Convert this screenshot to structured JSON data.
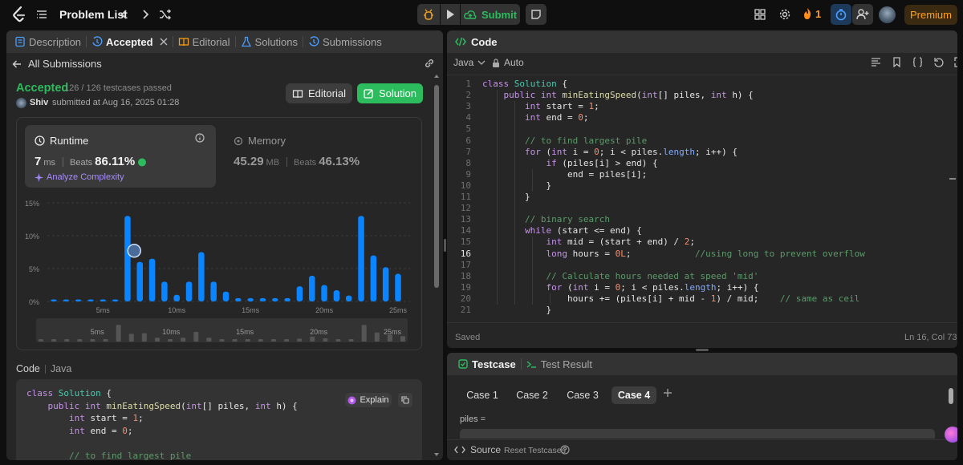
{
  "topbar": {
    "problem_list": "Problem List",
    "submit": "Submit",
    "streak": "1",
    "premium": "Premium"
  },
  "left_tabs": {
    "description": "Description",
    "accepted": "Accepted",
    "editorial": "Editorial",
    "solutions": "Solutions",
    "submissions": "Submissions"
  },
  "submission": {
    "back": "All Submissions",
    "status": "Accepted",
    "passed": "126 / 126 testcases passed",
    "user": "Shiv",
    "submitted": "submitted at Aug 16, 2025 01:28",
    "editorial_btn": "Editorial",
    "solution_btn": "Solution"
  },
  "stats": {
    "runtime_label": "Runtime",
    "runtime_value": "7",
    "runtime_unit": "ms",
    "beats_label": "Beats",
    "runtime_beats": "86.11%",
    "analyze": "Analyze Complexity",
    "memory_label": "Memory",
    "memory_value": "45.29",
    "memory_unit": "MB",
    "memory_beats": "46.13%"
  },
  "chart_data": {
    "type": "bar",
    "yticks": [
      "15%",
      "10%",
      "5%",
      "0%"
    ],
    "ylim": [
      0,
      15
    ],
    "xticks": [
      "5ms",
      "10ms",
      "15ms",
      "20ms",
      "25ms"
    ],
    "values": [
      0.3,
      0.3,
      0.3,
      0.3,
      0.3,
      0.3,
      13,
      6,
      6.5,
      3,
      1,
      3,
      7.5,
      3,
      1.5,
      0.5,
      0.5,
      0.5,
      0.5,
      0.5,
      2.3,
      3.9,
      2.5,
      1.7,
      0.9,
      13,
      7,
      5.2,
      4.2
    ],
    "highlight_index": 7,
    "mini_xticks": [
      "5ms",
      "10ms",
      "15ms",
      "20ms",
      "25ms"
    ]
  },
  "code_section": {
    "label": "Code",
    "lang": "Java",
    "explain": "Explain"
  },
  "editor": {
    "title": "Code",
    "lang": "Java",
    "auto": "Auto",
    "saved": "Saved",
    "cursor": "Ln 16, Col 73",
    "active_line": 16,
    "lines": [
      [
        [
          "kw",
          "class "
        ],
        [
          "cls",
          "Solution"
        ],
        [
          "id",
          " {"
        ]
      ],
      [
        [
          "id",
          "    "
        ],
        [
          "kw",
          "public "
        ],
        [
          "kw",
          "int "
        ],
        [
          "fn",
          "minEatingSpeed"
        ],
        [
          "id",
          "("
        ],
        [
          "kw",
          "int"
        ],
        [
          "id",
          "[] piles, "
        ],
        [
          "kw",
          "int "
        ],
        [
          "id",
          "h) {"
        ]
      ],
      [
        [
          "id",
          "        "
        ],
        [
          "kw",
          "int "
        ],
        [
          "id",
          "start = "
        ],
        [
          "nm",
          "1"
        ],
        [
          "id",
          ";"
        ]
      ],
      [
        [
          "id",
          "        "
        ],
        [
          "kw",
          "int "
        ],
        [
          "id",
          "end = "
        ],
        [
          "nm",
          "0"
        ],
        [
          "id",
          ";"
        ]
      ],
      [
        [
          "id",
          ""
        ]
      ],
      [
        [
          "id",
          "        "
        ],
        [
          "cm",
          "// to find largest pile"
        ]
      ],
      [
        [
          "id",
          "        "
        ],
        [
          "kw",
          "for "
        ],
        [
          "id",
          "("
        ],
        [
          "kw",
          "int "
        ],
        [
          "id",
          "i = "
        ],
        [
          "nm",
          "0"
        ],
        [
          "id",
          "; i < piles."
        ],
        [
          "ty",
          "length"
        ],
        [
          "id",
          "; i++) {"
        ]
      ],
      [
        [
          "id",
          "            "
        ],
        [
          "kw",
          "if "
        ],
        [
          "id",
          "(piles[i] > end) {"
        ]
      ],
      [
        [
          "id",
          "                end = piles[i];"
        ]
      ],
      [
        [
          "id",
          "            }"
        ]
      ],
      [
        [
          "id",
          "        }"
        ]
      ],
      [
        [
          "id",
          ""
        ]
      ],
      [
        [
          "id",
          "        "
        ],
        [
          "cm",
          "// binary search"
        ]
      ],
      [
        [
          "id",
          "        "
        ],
        [
          "kw",
          "while "
        ],
        [
          "id",
          "(start <= end) {"
        ]
      ],
      [
        [
          "id",
          "            "
        ],
        [
          "kw",
          "int "
        ],
        [
          "id",
          "mid = (start + end) / "
        ],
        [
          "nm",
          "2"
        ],
        [
          "id",
          ";"
        ]
      ],
      [
        [
          "id",
          "            "
        ],
        [
          "kw",
          "long "
        ],
        [
          "id",
          "hours = "
        ],
        [
          "nm",
          "0L"
        ],
        [
          "id",
          ";            "
        ],
        [
          "cm",
          "//using long to prevent overflow"
        ]
      ],
      [
        [
          "id",
          ""
        ]
      ],
      [
        [
          "id",
          "            "
        ],
        [
          "cm",
          "// Calculate hours needed at speed 'mid'"
        ]
      ],
      [
        [
          "id",
          "            "
        ],
        [
          "kw",
          "for "
        ],
        [
          "id",
          "("
        ],
        [
          "kw",
          "int "
        ],
        [
          "id",
          "i = "
        ],
        [
          "nm",
          "0"
        ],
        [
          "id",
          "; i < piles."
        ],
        [
          "ty",
          "length"
        ],
        [
          "id",
          "; i++) {"
        ]
      ],
      [
        [
          "id",
          "                hours += (piles[i] + mid - "
        ],
        [
          "nm",
          "1"
        ],
        [
          "id",
          ") / mid;    "
        ],
        [
          "cm",
          "// same as ceil"
        ]
      ],
      [
        [
          "id",
          "            }"
        ]
      ]
    ]
  },
  "left_code": [
    [
      [
        "kw",
        "class "
      ],
      [
        "cls",
        "Solution"
      ],
      [
        "id",
        " {"
      ]
    ],
    [
      [
        "id",
        "    "
      ],
      [
        "kw",
        "public "
      ],
      [
        "kw",
        "int "
      ],
      [
        "fn",
        "minEatingSpeed"
      ],
      [
        "id",
        "("
      ],
      [
        "kw",
        "int"
      ],
      [
        "id",
        "[] piles, "
      ],
      [
        "kw",
        "int "
      ],
      [
        "id",
        "h) {"
      ]
    ],
    [
      [
        "id",
        "        "
      ],
      [
        "kw",
        "int "
      ],
      [
        "id",
        "start = "
      ],
      [
        "nm",
        "1"
      ],
      [
        "id",
        ";"
      ]
    ],
    [
      [
        "id",
        "        "
      ],
      [
        "kw",
        "int "
      ],
      [
        "id",
        "end = "
      ],
      [
        "nm",
        "0"
      ],
      [
        "id",
        ";"
      ]
    ],
    [
      [
        "id",
        ""
      ]
    ],
    [
      [
        "id",
        "        "
      ],
      [
        "cm",
        "// to find largest pile"
      ]
    ]
  ],
  "testcase": {
    "title": "Testcase",
    "result": "Test Result",
    "cases": [
      "Case 1",
      "Case 2",
      "Case 3",
      "Case 4"
    ],
    "active_case": 3,
    "input_label": "piles =",
    "source": "Source",
    "reset": "Reset Testcases"
  }
}
